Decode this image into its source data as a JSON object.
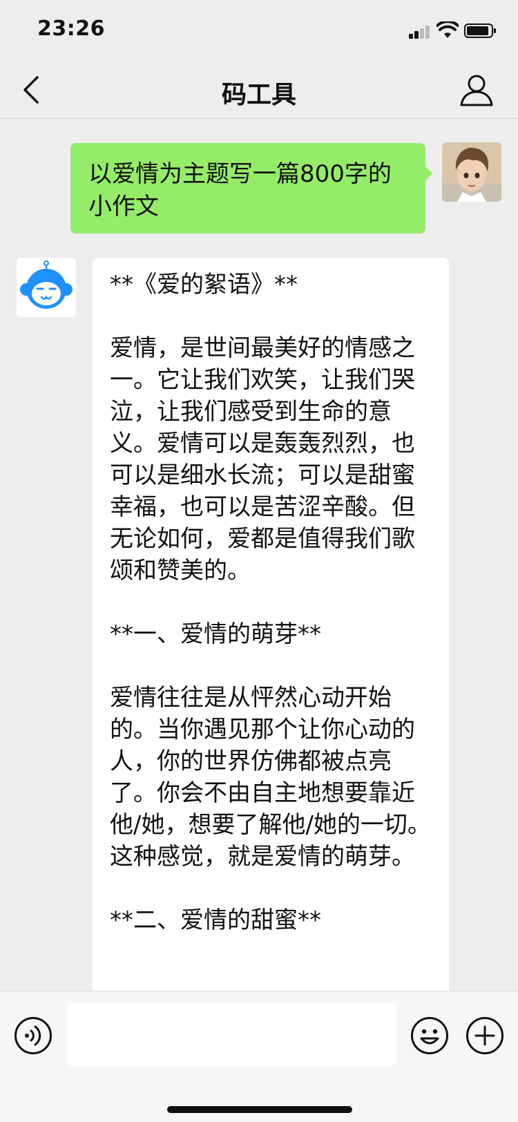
{
  "status_bar": {
    "time": "23:26"
  },
  "nav": {
    "title": "码工具"
  },
  "messages": {
    "user": {
      "text": "以爱情为主题写一篇800字的小作文"
    },
    "bot": {
      "paragraphs": [
        "**《爱的絮语》**",
        "爱情，是世间最美好的情感之一。它让我们欢笑，让我们哭泣，让我们感受到生命的意义。爱情可以是轰轰烈烈，也可以是细水长流；可以是甜蜜幸福，也可以是苦涩辛酸。但无论如何，爱都是值得我们歌颂和赞美的。",
        "**一、爱情的萌芽**",
        "爱情往往是从怦然心动开始的。当你遇见那个让你心动的人，你的世界仿佛都被点亮了。你会不由自主地想要靠近他/她，想要了解他/她的一切。这种感觉，就是爱情的萌芽。",
        "**二、爱情的甜蜜**"
      ]
    }
  },
  "input": {
    "value": ""
  },
  "colors": {
    "user_bubble": "#95ec69",
    "bot_bubble": "#ffffff",
    "background": "#ededed",
    "bot_avatar": "#1e90ff"
  },
  "icons": {
    "back": "chevron-left-icon",
    "profile": "person-icon",
    "voice": "voice-icon",
    "emoji": "smiley-icon",
    "add": "plus-circle-icon"
  }
}
